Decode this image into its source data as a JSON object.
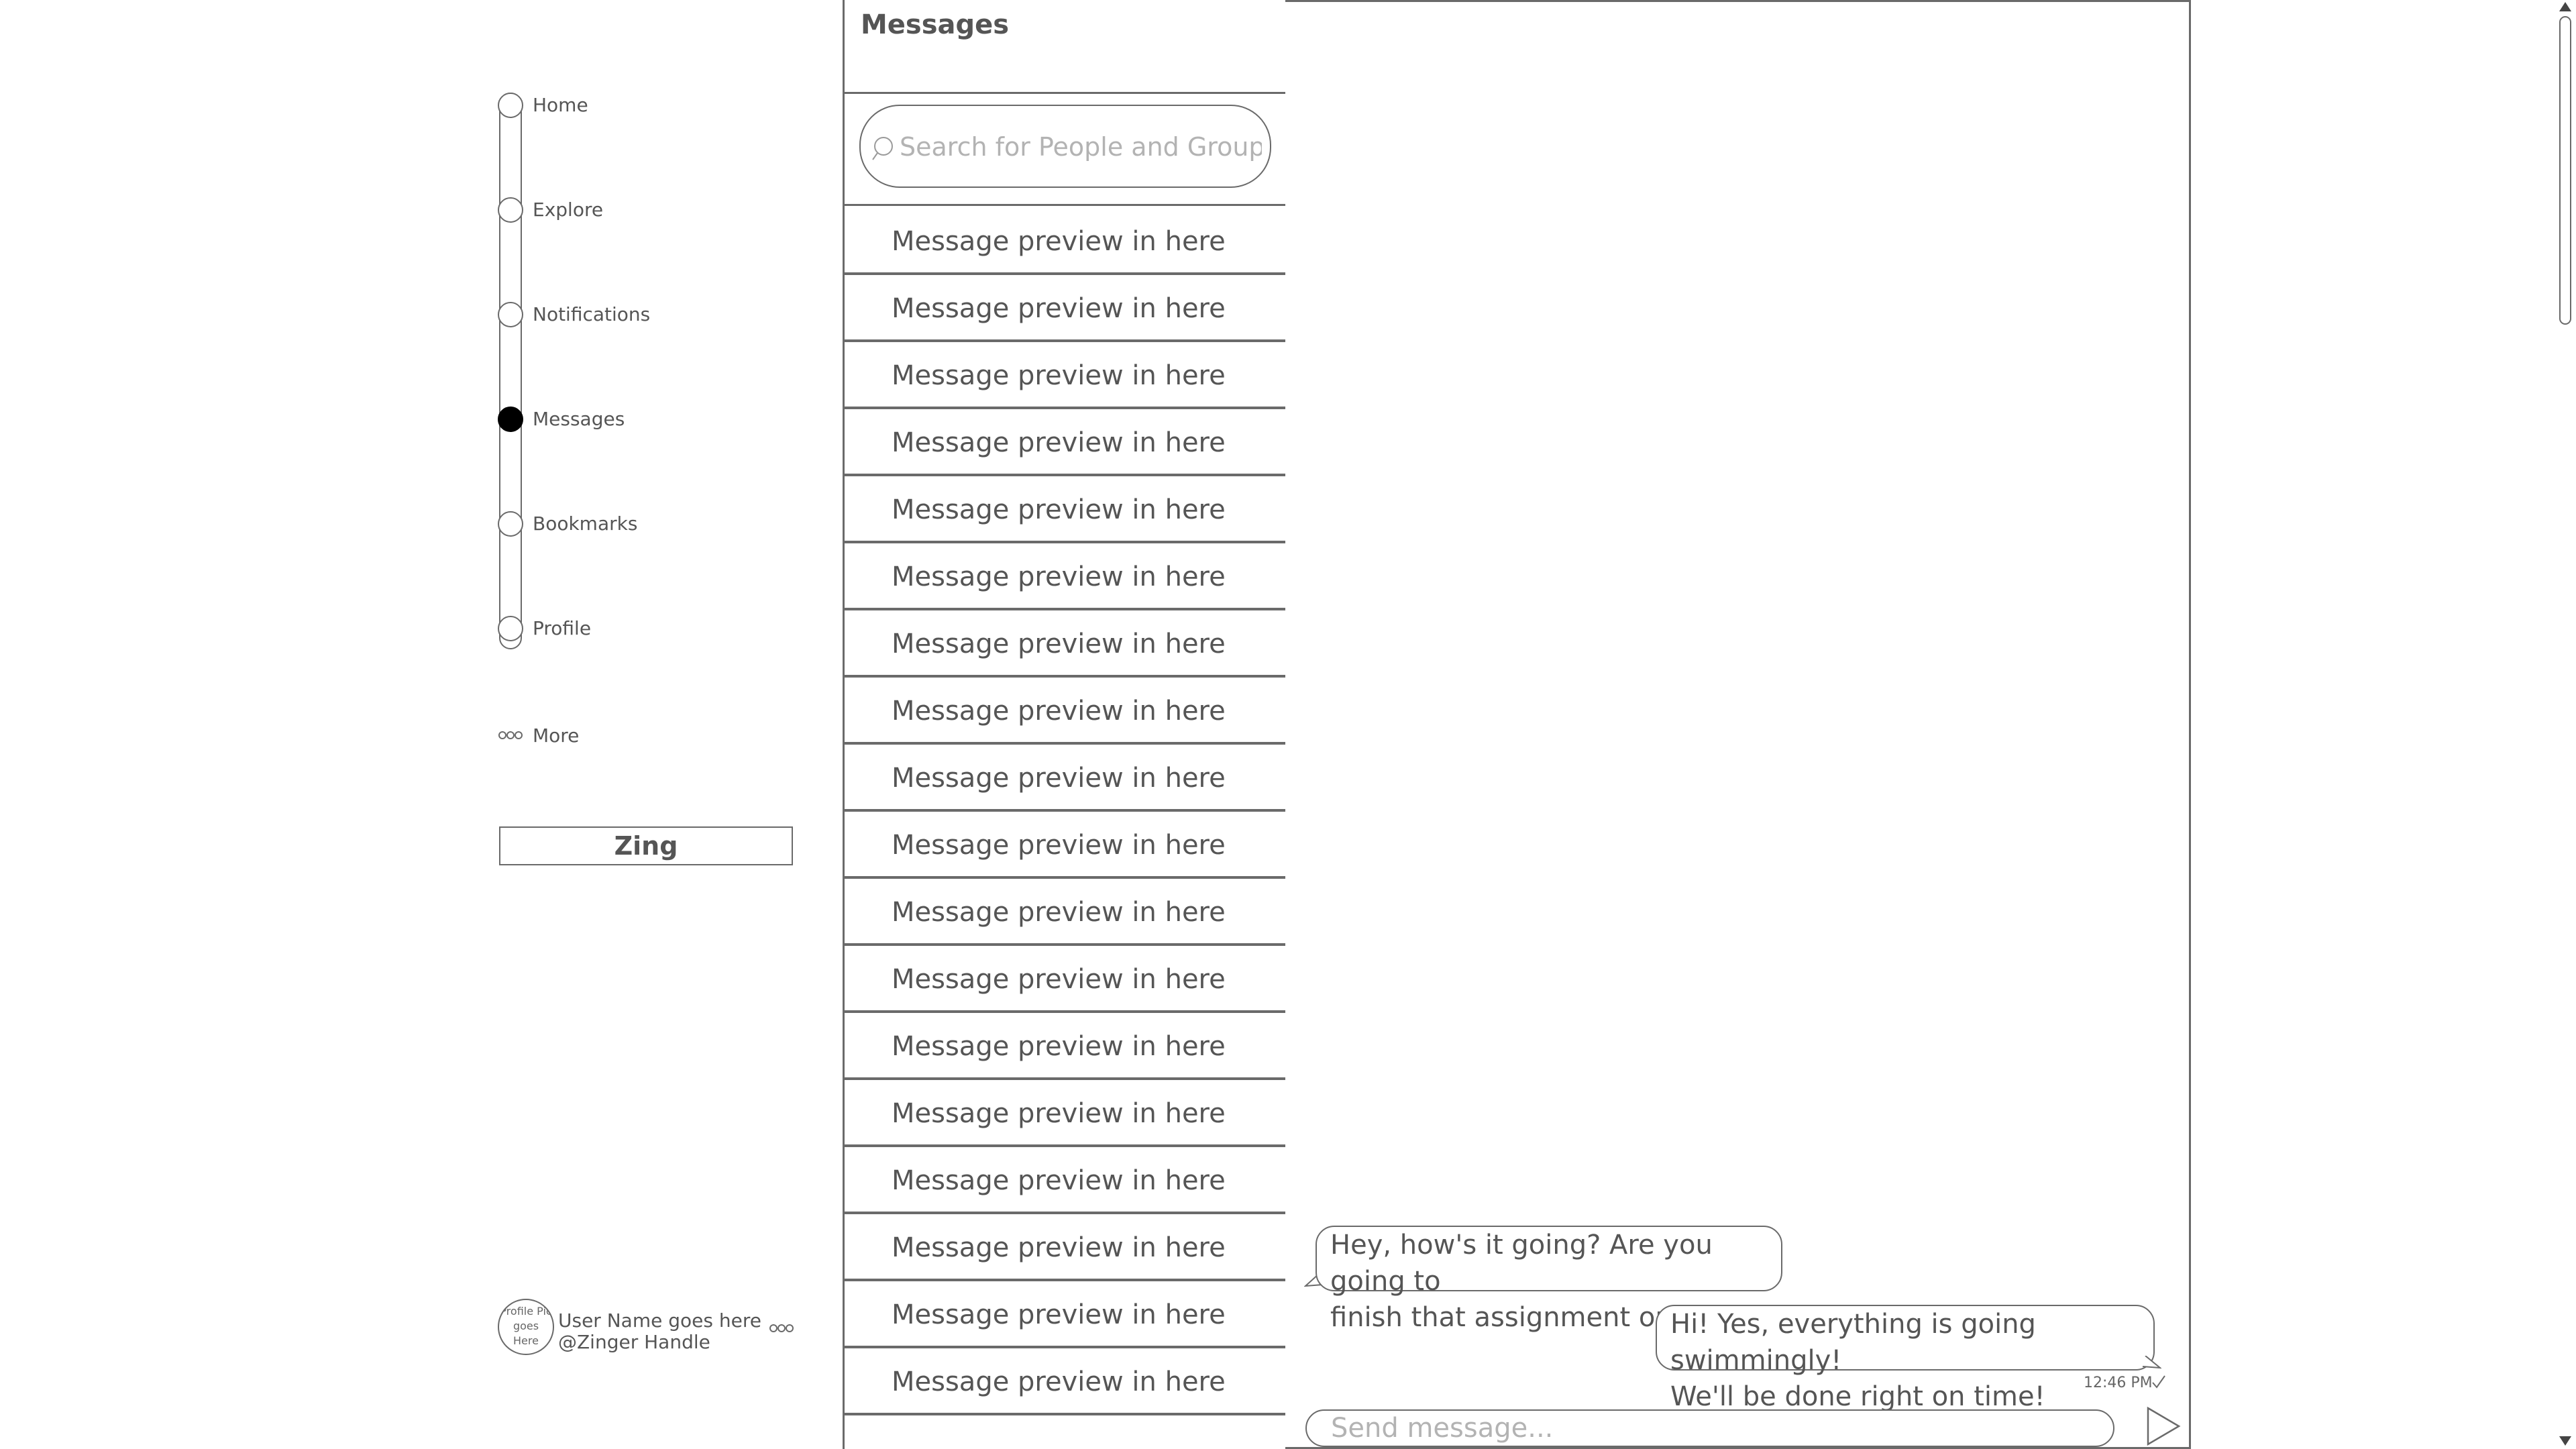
{
  "nav": {
    "items": [
      {
        "label": "Home",
        "active": false
      },
      {
        "label": "Explore",
        "active": false
      },
      {
        "label": "Notifications",
        "active": false
      },
      {
        "label": "Messages",
        "active": true
      },
      {
        "label": "Bookmarks",
        "active": false
      },
      {
        "label": "Profile",
        "active": false
      }
    ],
    "more_label": "More",
    "more_icon": "more-dots-icon",
    "compose_label": "Zing"
  },
  "user": {
    "avatar_text": "Profile Pic goes Here",
    "name": "User Name goes here",
    "handle": "@Zinger Handle",
    "more_icon": "more-dots-icon"
  },
  "messages": {
    "title": "Messages",
    "search_placeholder": "Search for People and Groups",
    "previews": [
      "Message preview in here",
      "Message preview in here",
      "Message preview in here",
      "Message preview in here",
      "Message preview in here",
      "Message preview in here",
      "Message preview in here",
      "Message preview in here",
      "Message preview in here",
      "Message preview in here",
      "Message preview in here",
      "Message preview in here",
      "Message preview in here",
      "Message preview in here",
      "Message preview in here",
      "Message preview in here",
      "Message preview in here",
      "Message preview in here"
    ]
  },
  "conversation": {
    "received": {
      "line1": "Hey, how's it going? Are you going to",
      "line2": "finish that assignment on time?"
    },
    "sent": {
      "line1": "Hi! Yes, everything is going swimmingly!",
      "line2": "We'll be done right on time!",
      "time": "12:46 PM"
    },
    "send_placeholder": "Send message...",
    "send_icon": "send-arrow-icon"
  },
  "colors": {
    "border": "#6a6a6a",
    "text": "#555555",
    "placeholder": "#b3b3b3",
    "active_dot": "#000000"
  }
}
